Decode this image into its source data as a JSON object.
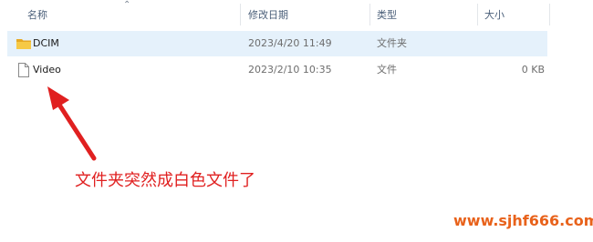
{
  "columns": {
    "name": "名称",
    "modified": "修改日期",
    "type": "类型",
    "size": "大小"
  },
  "files": [
    {
      "icon": "folder-icon",
      "name": "DCIM",
      "modified": "2023/4/20 11:49",
      "type": "文件夹",
      "size": "",
      "selected": true
    },
    {
      "icon": "file-icon",
      "name": "Video",
      "modified": "2023/2/10 10:35",
      "type": "文件",
      "size": "0 KB",
      "selected": false
    }
  ],
  "annotation": "文件夹突然成白色文件了",
  "watermark": "www.sjhf666.com",
  "colors": {
    "selection": "#e5f1fb",
    "folder": "#f3c443",
    "annotation": "#e02020",
    "watermark": "#e8621b"
  }
}
